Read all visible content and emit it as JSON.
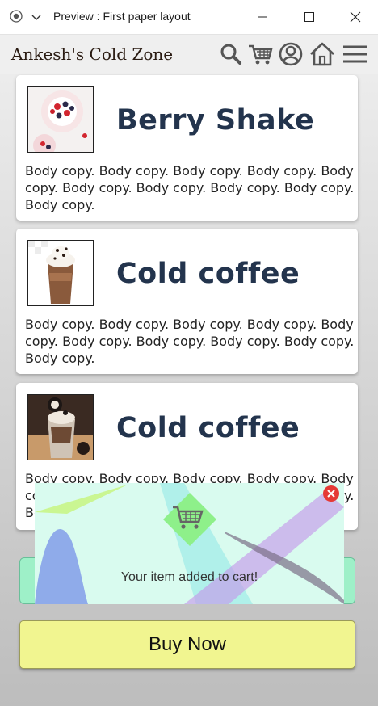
{
  "window": {
    "title": "Preview : First paper layout"
  },
  "header": {
    "brand": "Ankesh's Cold Zone",
    "icons": [
      "search-icon",
      "cart-icon",
      "user-icon",
      "home-icon",
      "menu-icon"
    ]
  },
  "products": [
    {
      "title": "Berry Shake",
      "body": "Body copy. Body copy. Body copy. Body copy. Body copy. Body copy. Body copy. Body copy. Body copy. Body copy."
    },
    {
      "title": "Cold coffee",
      "body": "Body copy. Body copy. Body copy. Body copy. Body copy. Body copy. Body copy. Body copy. Body copy. Body copy."
    },
    {
      "title": "Cold coffee",
      "body": "Body copy. Body copy. Body copy. Body copy. Body copy. Body copy. Body copy. Body copy. Body copy. Body copy."
    }
  ],
  "buttons": {
    "buy_now": "Buy Now"
  },
  "toast": {
    "message": "Your item added to cart!",
    "icon": "cart-icon"
  },
  "colors": {
    "title_text": "#23344d",
    "buy_button": "#f1f590",
    "toast_bg": "#d9fbef",
    "close": "#e53935"
  }
}
